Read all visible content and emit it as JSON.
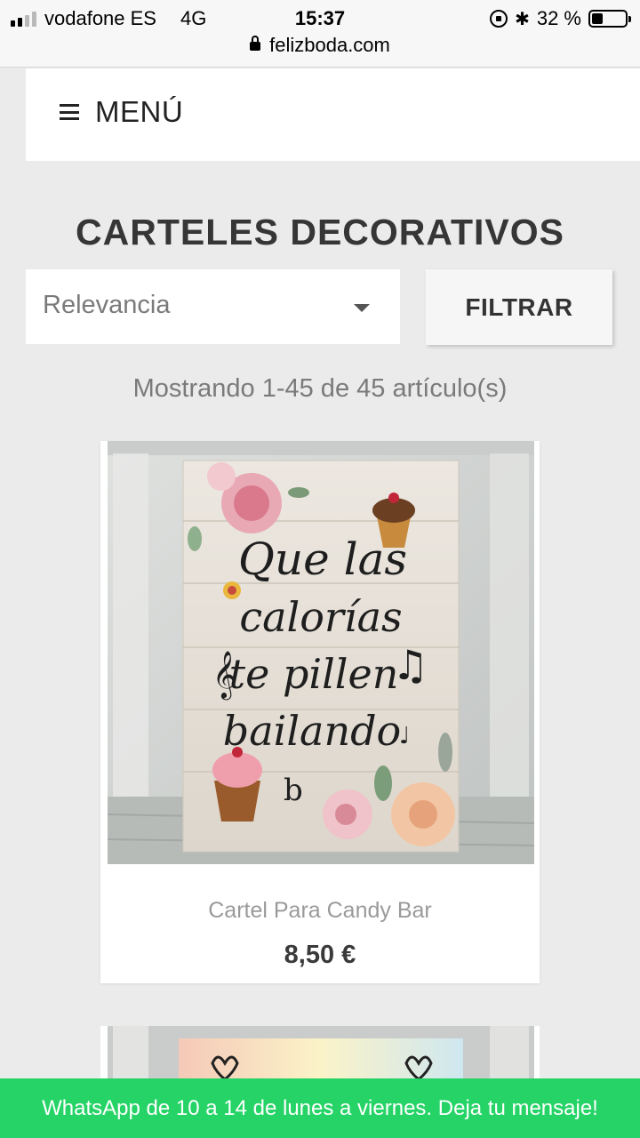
{
  "status_bar": {
    "carrier": "vodafone ES",
    "network": "4G",
    "time": "15:37",
    "battery_text": "32 %",
    "battery_level": 0.32,
    "url": "felizboda.com"
  },
  "header": {
    "menu_label": "MENÚ"
  },
  "category": {
    "title": "CARTELES DECORATIVOS",
    "sort_selected": "Relevancia",
    "filter_label": "FILTRAR",
    "results_text": "Mostrando 1-45 de 45 artículo(s)"
  },
  "products": [
    {
      "name": "Cartel Para Candy Bar",
      "price": "8,50 €",
      "sign_lines": [
        "Que las",
        "calorías",
        "te pillen",
        "bailando"
      ]
    }
  ],
  "banner": {
    "text": "WhatsApp de 10 a 14 de lunes a viernes. Deja tu mensaje!",
    "color": "#25d366"
  }
}
